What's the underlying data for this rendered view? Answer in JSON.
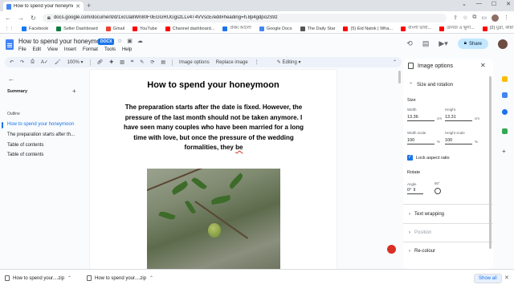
{
  "browser": {
    "tab_title": "How to spend your honeymoon",
    "url": "docs.google.com/document/d/1xcUa8Wn80F0EGGRUGgszLLv4T4VVscE/edit#heading=h.8p4gdpo2S9z",
    "bookmarks": [
      {
        "label": "Facebook",
        "color": "#1877f2"
      },
      {
        "label": "Seller Dashboard",
        "color": "#0b7d3e"
      },
      {
        "label": "Gmail",
        "color": "#ea4335"
      },
      {
        "label": "YouTube",
        "color": "#ff0000"
      },
      {
        "label": "Channel dashboard...",
        "color": "#ff0000"
      },
      {
        "label": "প্রথম আলো",
        "color": "#1a73e8"
      },
      {
        "label": "Google Docs",
        "color": "#4285f4"
      },
      {
        "label": "The Daily Star",
        "color": "#555555"
      },
      {
        "label": "(5) Eid Natok | Wha...",
        "color": "#ff0000"
      },
      {
        "label": "বাংলা ভাষা...",
        "color": "#ff0000"
      },
      {
        "label": "ত্রানজ ও ক্ষুদা...",
        "color": "#ff0000"
      },
      {
        "label": "(2) মুদ্রা, কান্না কিয়া...",
        "color": "#ff0000"
      }
    ]
  },
  "doc": {
    "title": "How to spend your honeymoon",
    "badge": "DOCX",
    "menu": [
      "File",
      "Edit",
      "View",
      "Insert",
      "Format",
      "Tools",
      "Help"
    ],
    "share_label": "Share"
  },
  "toolbar": {
    "zoom": "100%",
    "image_options": "Image options",
    "replace_image": "Replace image",
    "mode": "Editing"
  },
  "sidebar": {
    "summary_label": "Summary",
    "outline_label": "Outline",
    "outline_items": [
      "How to spend your honeymoon",
      "The preparation starts after th...",
      "Table of contents",
      "Table of contents"
    ]
  },
  "document": {
    "heading": "How to spend your honeymoon",
    "body": "The preparation starts after the date is fixed. However, the pressure of the last month should not be taken anymore. I have   seen many couples who have been married for a long time with love, but once the pressure of the wedding formalities, they",
    "body_tail": "be"
  },
  "image_options": {
    "title": "Image options",
    "size_rotation": "Size and rotation",
    "size_label": "Size",
    "width_label": "Width",
    "width_value": "13.36",
    "height_label": "Height",
    "height_value": "13.31",
    "unit_cm": "cm",
    "width_scale_label": "Width scale",
    "width_scale_value": "100",
    "height_scale_label": "Height scale",
    "height_scale_value": "100",
    "unit_pct": "%",
    "lock_aspect": "Lock aspect ratio",
    "lock_checked": true,
    "rotate_label": "Rotate",
    "angle_label": "Angle",
    "angle_value": "0",
    "angle_unit": "°",
    "angle_preset": "90°",
    "text_wrapping": "Text wrapping",
    "position": "Position",
    "recolour": "Re-colour"
  },
  "downloads": {
    "items": [
      "How to spend your....zip",
      "How to spend your....zip"
    ],
    "show_all": "Show all"
  },
  "colors": {
    "accent": "#1a73e8",
    "share_bg": "#c2e7ff",
    "toolbar_bg": "#edf2fa"
  }
}
